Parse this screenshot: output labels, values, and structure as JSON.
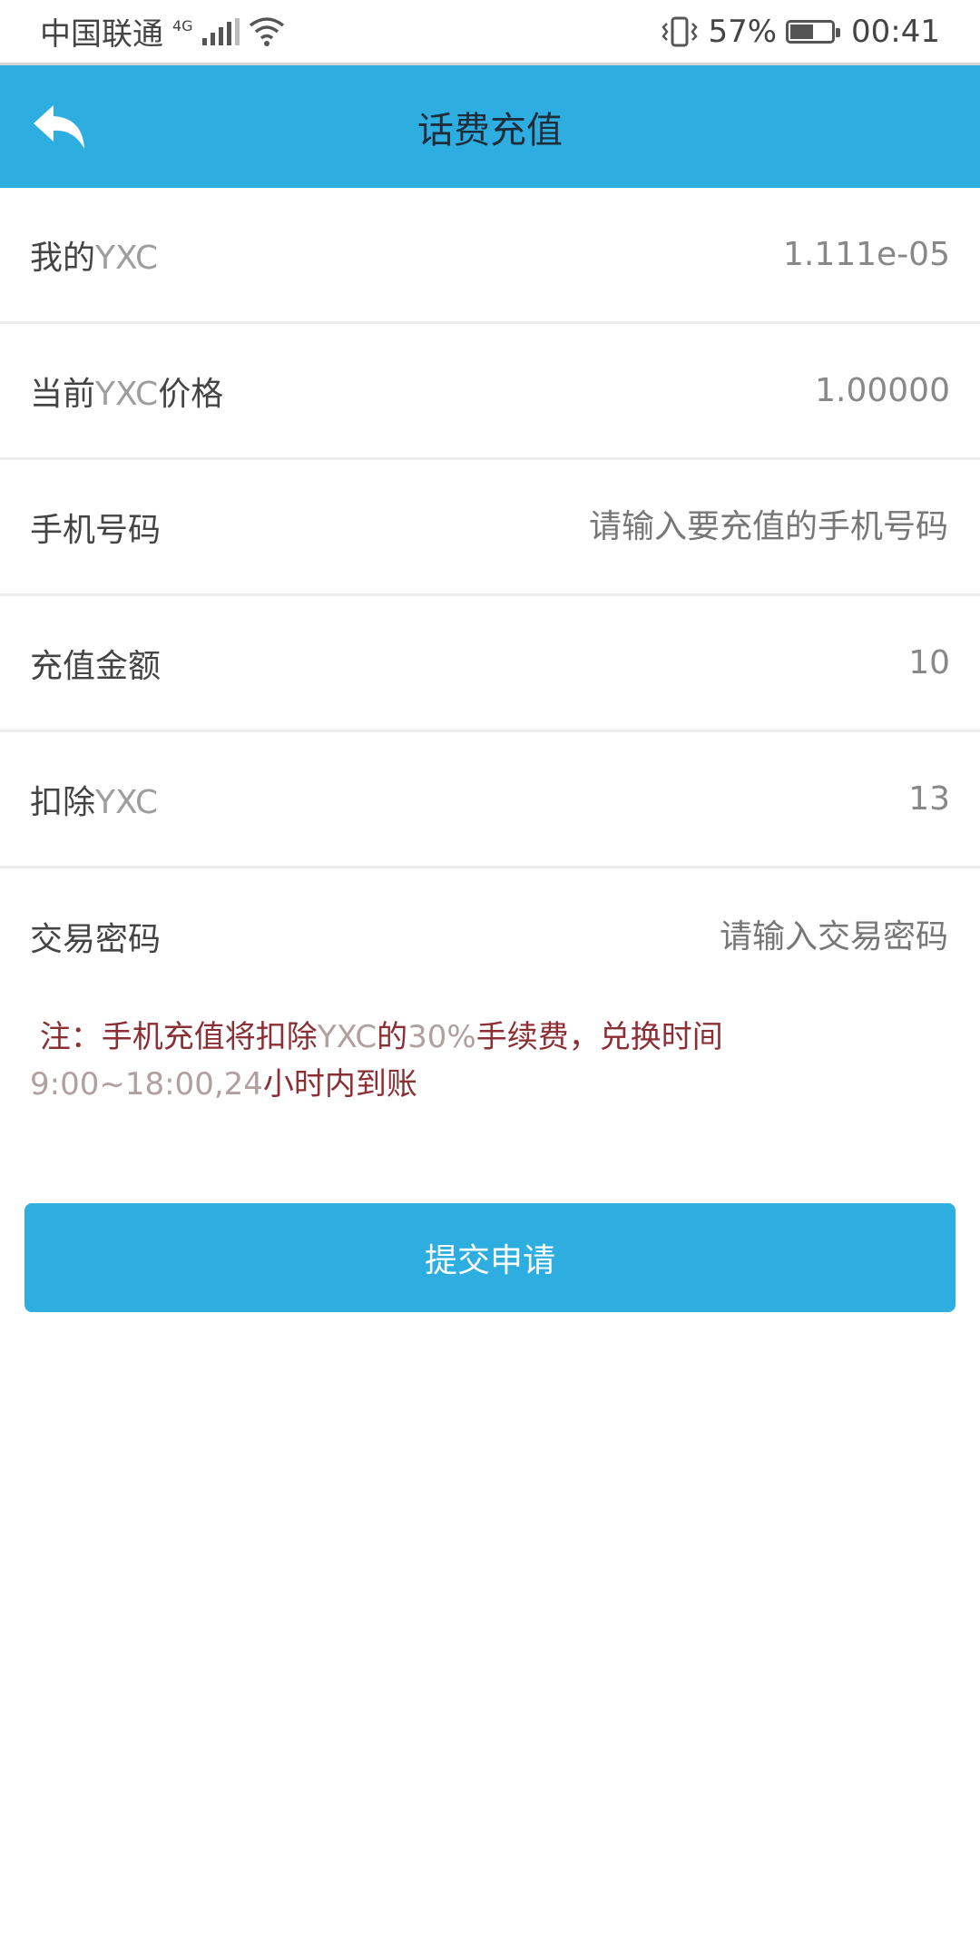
{
  "status_bar": {
    "carrier": "中国联通",
    "network": "4G",
    "battery": "57%",
    "battery_level": 0.57,
    "time": "00:41"
  },
  "header": {
    "title": "话费充值",
    "back_icon": "back-arrow-icon"
  },
  "form": {
    "my_yxc": {
      "label_cn": "我的",
      "label_latin": "YXC",
      "value": "1.111e-05"
    },
    "price": {
      "label_cn": "当前",
      "label_latin": "YXC",
      "label_suffix": "价格",
      "value": "1.00000"
    },
    "phone": {
      "label": "手机号码",
      "placeholder": "请输入要充值的手机号码",
      "value": ""
    },
    "amount": {
      "label": "充值金额",
      "value": "10"
    },
    "deduct": {
      "label_cn": "扣除",
      "label_latin": "YXC",
      "value": "13"
    },
    "password": {
      "label": "交易密码",
      "placeholder": "请输入交易密码",
      "value": ""
    }
  },
  "note": {
    "part1": "注：手机充值将扣除",
    "part2": "YXC",
    "part3": "的",
    "part4": "30%",
    "part5": "手续费，兑换时间",
    "part6": "9:00~18:00,24",
    "part7": "小时内到账"
  },
  "submit_label": "提交申请",
  "colors": {
    "accent": "#2eaee0",
    "note": "#8b2f35"
  }
}
